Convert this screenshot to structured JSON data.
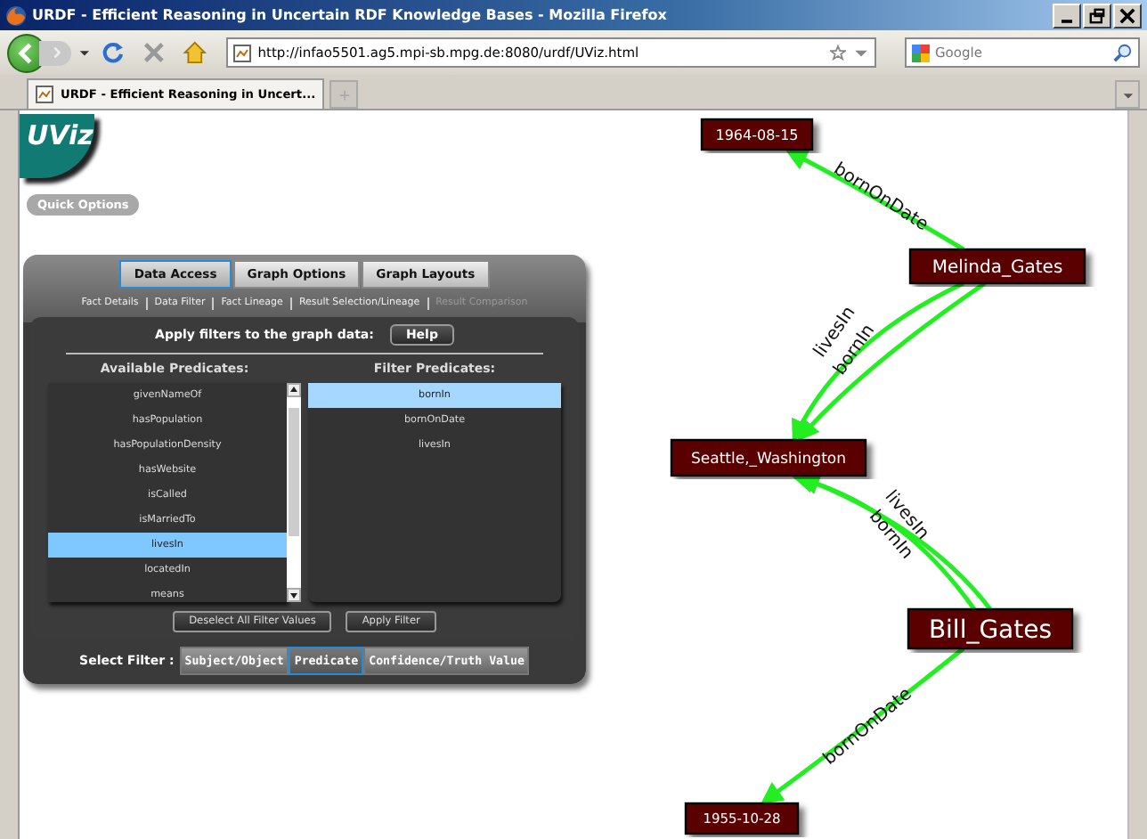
{
  "window": {
    "title": "URDF - Efficient Reasoning in Uncertain RDF Knowledge Bases - Mozilla Firefox"
  },
  "address_bar": {
    "value": "http://infao5501.ag5.mpi-sb.mpg.de:8080/urdf/UViz.html"
  },
  "search": {
    "placeholder": "Google"
  },
  "tabs": [
    {
      "label": "URDF - Efficient Reasoning in Uncert...",
      "selected": true
    }
  ],
  "app": {
    "logo": "UViz",
    "quick_options": "Quick Options",
    "panel_tabs": [
      {
        "label": "Data Access",
        "selected": true
      },
      {
        "label": "Graph Options",
        "selected": false
      },
      {
        "label": "Graph Layouts",
        "selected": false
      }
    ],
    "sub_links": [
      {
        "label": "Fact Details",
        "disabled": false
      },
      {
        "label": "Data Filter",
        "disabled": false
      },
      {
        "label": "Fact Lineage",
        "disabled": false
      },
      {
        "label": "Result Selection/Lineage",
        "disabled": false
      },
      {
        "label": "Result Comparison",
        "disabled": true
      }
    ],
    "filter_prompt": "Apply filters to the graph data:",
    "help_button": "Help",
    "available_title": "Available Predicates:",
    "filter_title": "Filter Predicates:",
    "available_predicates": [
      {
        "label": "givenNameOf",
        "selected": false
      },
      {
        "label": "hasPopulation",
        "selected": false
      },
      {
        "label": "hasPopulationDensity",
        "selected": false
      },
      {
        "label": "hasWebsite",
        "selected": false
      },
      {
        "label": "isCalled",
        "selected": false
      },
      {
        "label": "isMarriedTo",
        "selected": false
      },
      {
        "label": "livesIn",
        "selected": true
      },
      {
        "label": "locatedIn",
        "selected": false
      },
      {
        "label": "means",
        "selected": false
      }
    ],
    "filter_predicates": [
      {
        "label": "bornIn",
        "selected": true
      },
      {
        "label": "bornOnDate",
        "selected": false
      },
      {
        "label": "livesIn",
        "selected": false
      }
    ],
    "deselect_button": "Deselect All Filter Values",
    "apply_button": "Apply Filter",
    "select_filter_label": "Select Filter :",
    "filter_modes": [
      {
        "label": "Subject/Object",
        "selected": false
      },
      {
        "label": "Predicate",
        "selected": true
      },
      {
        "label": "Confidence/Truth Value",
        "selected": false
      }
    ]
  },
  "graph": {
    "nodes": [
      {
        "label": "1964-08-15"
      },
      {
        "label": "Melinda_Gates"
      },
      {
        "label": "Seattle,_Washington"
      },
      {
        "label": "Bill_Gates"
      },
      {
        "label": "1955-10-28"
      }
    ],
    "edges": [
      {
        "label": "bornOnDate"
      },
      {
        "label": "livesIn"
      },
      {
        "label": "bornIn"
      },
      {
        "label": "livesIn"
      },
      {
        "label": "bornIn"
      },
      {
        "label": "bornOnDate"
      }
    ]
  }
}
